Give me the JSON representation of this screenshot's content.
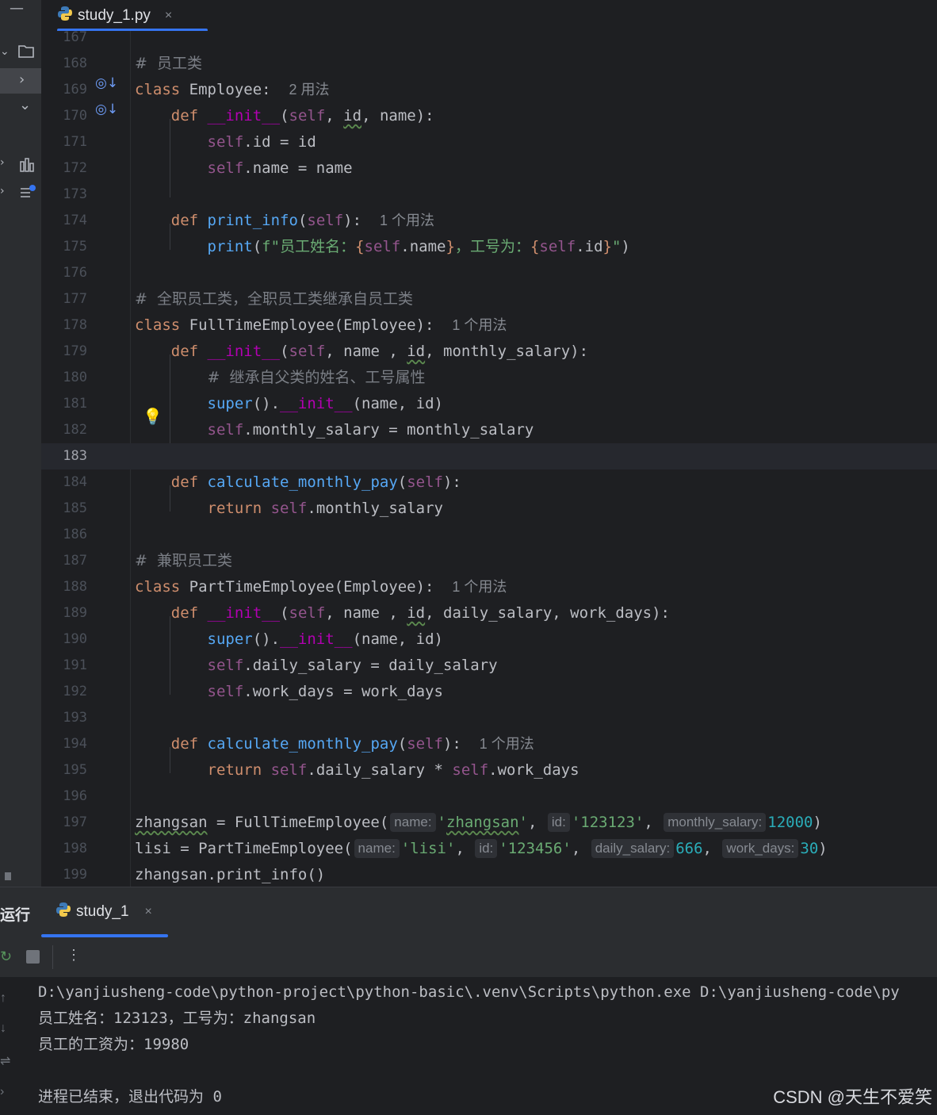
{
  "tab": {
    "filename": "study_1.py",
    "close": "×"
  },
  "editor": {
    "lines": [
      {
        "n": "167"
      },
      {
        "n": "168"
      },
      {
        "n": "169"
      },
      {
        "n": "170"
      },
      {
        "n": "171"
      },
      {
        "n": "172"
      },
      {
        "n": "173"
      },
      {
        "n": "174"
      },
      {
        "n": "175"
      },
      {
        "n": "176"
      },
      {
        "n": "177"
      },
      {
        "n": "178"
      },
      {
        "n": "179"
      },
      {
        "n": "180"
      },
      {
        "n": "181"
      },
      {
        "n": "182"
      },
      {
        "n": "183"
      },
      {
        "n": "184"
      },
      {
        "n": "185"
      },
      {
        "n": "186"
      },
      {
        "n": "187"
      },
      {
        "n": "188"
      },
      {
        "n": "189"
      },
      {
        "n": "190"
      },
      {
        "n": "191"
      },
      {
        "n": "192"
      },
      {
        "n": "193"
      },
      {
        "n": "194"
      },
      {
        "n": "195"
      },
      {
        "n": "196"
      },
      {
        "n": "197"
      },
      {
        "n": "198"
      },
      {
        "n": "199"
      }
    ],
    "current_line": "183",
    "code": {
      "c168": "#  员工类",
      "c169_kw": "class",
      "c169_name": " Employee:",
      "c169_use": "2 用法",
      "c170_def": "def",
      "c170_fn": "__init__",
      "c170_a": "(",
      "c170_self": "self",
      "c170_b": ", ",
      "c170_id": "id",
      "c170_c": ", name):",
      "c171_self": "self",
      "c171_rest": ".id = id",
      "c172_self": "self",
      "c172_rest": ".name = name",
      "c174_def": "def",
      "c174_fn": "print_info",
      "c174_a": "(",
      "c174_self": "self",
      "c174_b": "):",
      "c174_use": "1 个用法",
      "c175_print": "print",
      "c175_a": "(",
      "c175_f": "f\"",
      "c175_s1": "员工姓名：",
      "c175_b1": "{",
      "c175_self1": "self",
      "c175_v1": ".name",
      "c175_b2": "}",
      "c175_s2": "，工号为：",
      "c175_b3": "{",
      "c175_self2": "self",
      "c175_v2": ".id",
      "c175_b4": "}",
      "c175_q": "\"",
      "c175_z": ")",
      "c177": "#  全职员工类，全职员工类继承自员工类",
      "c178_kw": "class",
      "c178_name": " FullTimeEmployee(Employee):",
      "c178_use": "1 个用法",
      "c179_def": "def",
      "c179_fn": "__init__",
      "c179_a": "(",
      "c179_self": "self",
      "c179_b": ", name , ",
      "c179_id": "id",
      "c179_c": ", monthly_salary):",
      "c180": "#  继承自父类的姓名、工号属性",
      "c181_super": "super",
      "c181_a": "().",
      "c181_init": "__init__",
      "c181_b": "(name, id)",
      "c182_self": "self",
      "c182_rest": ".monthly_salary = monthly_salary",
      "c184_def": "def",
      "c184_fn": "calculate_monthly_pay",
      "c184_a": "(",
      "c184_self": "self",
      "c184_b": "):",
      "c185_ret": "return",
      "c185_self": "self",
      "c185_rest": ".monthly_salary",
      "c187": "#  兼职员工类",
      "c188_kw": "class",
      "c188_name": " PartTimeEmployee(Employee):",
      "c188_use": "1 个用法",
      "c189_def": "def",
      "c189_fn": "__init__",
      "c189_a": "(",
      "c189_self": "self",
      "c189_b": ", name , ",
      "c189_id": "id",
      "c189_c": ", daily_salary, work_days):",
      "c190_super": "super",
      "c190_a": "().",
      "c190_init": "__init__",
      "c190_b": "(name, id)",
      "c191_self": "self",
      "c191_rest": ".daily_salary = daily_salary",
      "c192_self": "self",
      "c192_rest": ".work_days = work_days",
      "c194_def": "def",
      "c194_fn": "calculate_monthly_pay",
      "c194_a": "(",
      "c194_self": "self",
      "c194_b": "):",
      "c194_use": "1 个用法",
      "c195_ret": "return",
      "c195_self": "self",
      "c195_r1": ".daily_salary * ",
      "c195_self2": "self",
      "c195_r2": ".work_days",
      "c197_var": "zhangsan",
      "c197_a": " = FullTimeEmployee(",
      "c197_h1": "name:",
      "c197_q1": "'",
      "c197_s1": "zhangsan",
      "c197_q1b": "'",
      "c197_sep1": ", ",
      "c197_h2": "id:",
      "c197_s2": "'123123'",
      "c197_sep2": ", ",
      "c197_h3": "monthly_salary:",
      "c197_n": "12000",
      "c197_z": ")",
      "c198_a": "lisi = PartTimeEmployee(",
      "c198_h1": "name:",
      "c198_s1": "'lisi'",
      "c198_sep1": ", ",
      "c198_h2": "id:",
      "c198_s2": "'123456'",
      "c198_sep2": ", ",
      "c198_h3": "daily_salary:",
      "c198_n1": "666",
      "c198_sep3": ", ",
      "c198_h4": "work_days:",
      "c198_n2": "30",
      "c198_z": ")",
      "c199": "zhangsan.print_info()"
    }
  },
  "run": {
    "title": "运行",
    "tab_label": "study_1",
    "tab_close": "×",
    "console": [
      "D:\\yanjiusheng-code\\python-project\\python-basic\\.venv\\Scripts\\python.exe D:\\yanjiusheng-code\\py",
      "员工姓名：123123，工号为：zhangsan",
      "员工的工资为：19980",
      "",
      "进程已结束，退出代码为 0"
    ]
  },
  "watermark": "CSDN @天生不爱笑",
  "colors": {
    "accent": "#3574f0",
    "keyword": "#cf8e6d",
    "function": "#56a8f5",
    "self": "#94558d",
    "magic": "#b200b2",
    "string": "#6aab73",
    "number": "#2aacb8",
    "comment": "#7a7e85"
  }
}
